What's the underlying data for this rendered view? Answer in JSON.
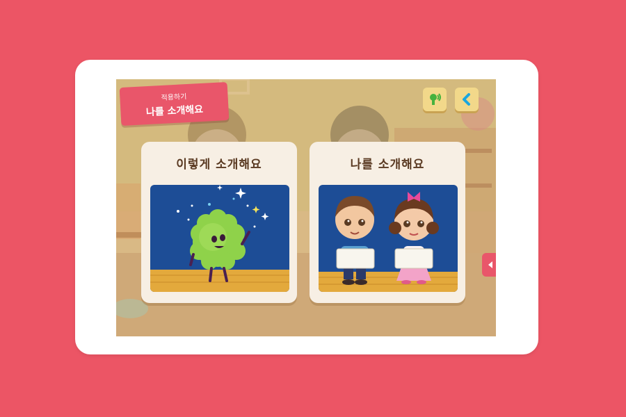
{
  "badge": {
    "subtitle": "적용하기",
    "title": "나를 소개해요"
  },
  "cards": [
    {
      "title": "이렇게 소개해요"
    },
    {
      "title": "나를 소개해요"
    }
  ],
  "icons": {
    "sound": "speaker-sound-icon",
    "back": "chevron-left-icon",
    "side": "triangle-left-icon"
  },
  "colors": {
    "page_bg": "#ec5565",
    "badge": "#e9566a",
    "button": "#f2d88a",
    "back_arrow": "#1aa6e0",
    "sound_icon": "#46b23e",
    "card_bg": "#f7efe4",
    "stage_blue": "#1d4d96",
    "stage_floor": "#e3a93c"
  }
}
